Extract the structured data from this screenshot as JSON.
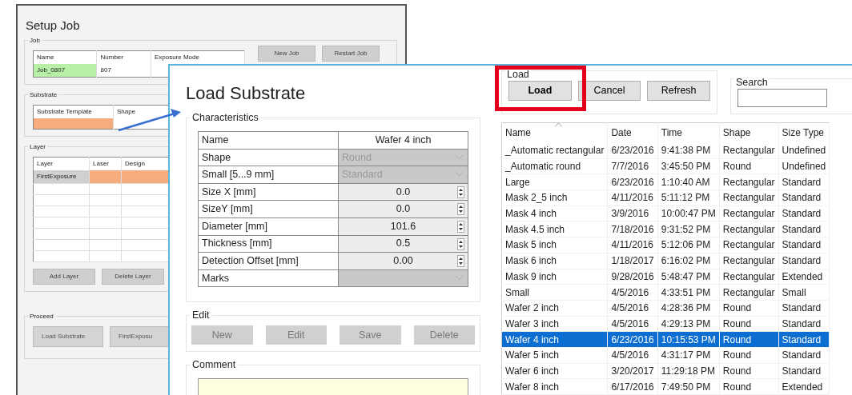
{
  "setup_job": {
    "title": "Setup Job",
    "job": {
      "legend": "Job",
      "columns": [
        "Name",
        "Number",
        "Exposure Mode"
      ],
      "values": [
        "Job_0807",
        "807"
      ],
      "buttons": [
        "New Job",
        "Restart Job"
      ]
    },
    "substrate": {
      "legend": "Substrate",
      "columns": [
        "Substrate Template",
        "Shape"
      ]
    },
    "layer": {
      "legend": "Layer",
      "columns": [
        "Layer",
        "Laser",
        "Design"
      ],
      "rows": [
        [
          "FirstExposure"
        ]
      ],
      "buttons": [
        "Add Layer",
        "Delete Layer"
      ]
    },
    "proceed": {
      "legend": "Proceed",
      "buttons": [
        {
          "label": "Load Substrate",
          "disabled": true
        },
        {
          "label": "FirstExposu",
          "disabled": true
        }
      ]
    }
  },
  "load_substrate": {
    "title": "Load Substrate",
    "characteristics": {
      "legend": "Characteristics",
      "rows": [
        {
          "label": "Name",
          "value": "Wafer 4 inch",
          "kind": "text"
        },
        {
          "label": "Shape",
          "value": "Round",
          "kind": "combo"
        },
        {
          "label": "Small [5...9 mm]",
          "value": "Standard",
          "kind": "combo"
        },
        {
          "label": "Size X [mm]",
          "value": "0.0",
          "kind": "spin"
        },
        {
          "label": "SizeY [mm]",
          "value": "0.0",
          "kind": "spin"
        },
        {
          "label": "Diameter [mm]",
          "value": "101.6",
          "kind": "spin"
        },
        {
          "label": "Thickness [mm]",
          "value": "0.5",
          "kind": "spin"
        },
        {
          "label": "Detection Offset [mm]",
          "value": "0.00",
          "kind": "spin"
        },
        {
          "label": "Marks",
          "kind": "combo"
        }
      ]
    },
    "edit": {
      "legend": "Edit",
      "buttons": [
        {
          "label": "New",
          "disabled": true
        },
        {
          "label": "Edit",
          "disabled": true
        },
        {
          "label": "Save",
          "disabled": true
        },
        {
          "label": "Delete",
          "disabled": true
        }
      ]
    },
    "comment": {
      "legend": "Comment"
    },
    "load": {
      "legend": "Load",
      "highlighted": true,
      "buttons": [
        "Load",
        "Cancel",
        "Refresh"
      ]
    },
    "search": {
      "legend": "Search"
    },
    "table": {
      "columns": [
        "Name",
        "Date",
        "Time",
        "Shape",
        "Size Type"
      ],
      "rows": [
        {
          "cells": [
            "_Automatic rectangular",
            "6/23/2016",
            "9:41:38 PM",
            "Rectangular",
            "Undefined"
          ],
          "selected": false
        },
        {
          "cells": [
            "_Automatic round",
            "7/7/2016",
            "3:45:50 PM",
            "Round",
            "Undefined"
          ],
          "selected": false
        },
        {
          "cells": [
            "Large",
            "6/23/2016",
            "1:10:40 AM",
            "Rectangular",
            "Standard"
          ],
          "selected": false
        },
        {
          "cells": [
            "Mask 2_5 inch",
            "4/11/2016",
            "5:11:12 PM",
            "Rectangular",
            "Standard"
          ],
          "selected": false
        },
        {
          "cells": [
            "Mask 4 inch",
            "3/9/2016",
            "10:00:47 PM",
            "Rectangular",
            "Standard"
          ],
          "selected": false
        },
        {
          "cells": [
            "Mask 4.5 inch",
            "7/18/2016",
            "9:31:52 PM",
            "Rectangular",
            "Standard"
          ],
          "selected": false
        },
        {
          "cells": [
            "Mask 5 inch",
            "4/11/2016",
            "5:12:06 PM",
            "Rectangular",
            "Standard"
          ],
          "selected": false
        },
        {
          "cells": [
            "Mask 6 inch",
            "1/18/2017",
            "6:16:02 PM",
            "Rectangular",
            "Standard"
          ],
          "selected": false
        },
        {
          "cells": [
            "Mask 9 inch",
            "9/28/2016",
            "5:48:47 PM",
            "Rectangular",
            "Extended"
          ],
          "selected": false
        },
        {
          "cells": [
            "Small",
            "4/5/2016",
            "4:33:51 PM",
            "Rectangular",
            "Small"
          ],
          "selected": false
        },
        {
          "cells": [
            "Wafer 2 inch",
            "4/5/2016",
            "4:28:36 PM",
            "Round",
            "Standard"
          ],
          "selected": false
        },
        {
          "cells": [
            "Wafer 3 inch",
            "4/5/2016",
            "4:29:13 PM",
            "Round",
            "Standard"
          ],
          "selected": false
        },
        {
          "cells": [
            "Wafer 4 inch",
            "6/23/2016",
            "10:15:53 PM",
            "Round",
            "Standard"
          ],
          "selected": true
        },
        {
          "cells": [
            "Wafer 5 inch",
            "4/5/2016",
            "4:31:17 PM",
            "Round",
            "Standard"
          ],
          "selected": false
        },
        {
          "cells": [
            "Wafer 6 inch",
            "3/20/2017",
            "11:29:18 PM",
            "Round",
            "Standard"
          ],
          "selected": false
        },
        {
          "cells": [
            "Wafer 8 inch",
            "6/17/2016",
            "7:49:50 PM",
            "Round",
            "Extended"
          ],
          "selected": false
        }
      ]
    }
  }
}
